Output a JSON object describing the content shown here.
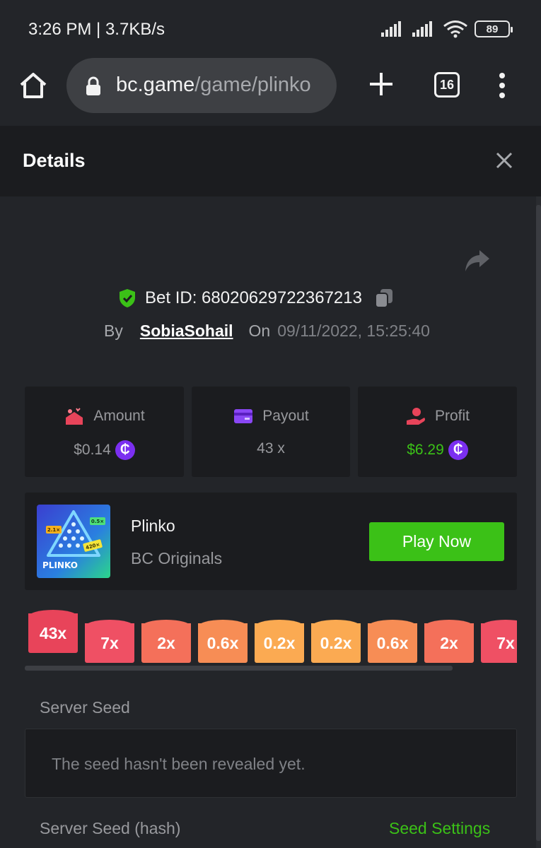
{
  "status_bar": {
    "time": "3:26 PM | 3.7KB/s",
    "battery": "89"
  },
  "browser": {
    "url_host": "bc.game",
    "url_path": "/game/plinko",
    "tab_count": "16"
  },
  "details": {
    "title": "Details"
  },
  "bet": {
    "id_label": "Bet ID: 68020629722367213",
    "by_label": "By",
    "username": "SobiaSohail",
    "on_label": "On",
    "date": "09/11/2022, 15:25:40"
  },
  "stats": {
    "amount": {
      "label": "Amount",
      "value": "$0.14"
    },
    "payout": {
      "label": "Payout",
      "value": "43 x"
    },
    "profit": {
      "label": "Profit",
      "value": "$6.29"
    }
  },
  "coin_symbol": "₵",
  "game": {
    "name": "Plinko",
    "provider": "BC Originals",
    "play_label": "Play Now",
    "thumb_title": "PLINKO",
    "thumb_chips": [
      "2.1×",
      "0.5×",
      "420×"
    ]
  },
  "buckets": [
    {
      "label": "43x",
      "color": "#e8445a",
      "active": true
    },
    {
      "label": "7x",
      "color": "#ef5064"
    },
    {
      "label": "2x",
      "color": "#f4705a"
    },
    {
      "label": "0.6x",
      "color": "#f78d55"
    },
    {
      "label": "0.2x",
      "color": "#fbaa52"
    },
    {
      "label": "0.2x",
      "color": "#fbaa52"
    },
    {
      "label": "0.6x",
      "color": "#f78d55"
    },
    {
      "label": "2x",
      "color": "#f4705a"
    },
    {
      "label": "7x",
      "color": "#ef5064"
    }
  ],
  "seed": {
    "server_seed_label": "Server Seed",
    "server_seed_placeholder": "The seed hasn't been revealed yet.",
    "server_seed_hash_label": "Server Seed (hash)",
    "seed_settings_label": "Seed Settings"
  },
  "colors": {
    "accent_green": "#3bc117",
    "coin_purple": "#7b2ff0",
    "background": "#232529",
    "card": "#1b1c1f"
  }
}
